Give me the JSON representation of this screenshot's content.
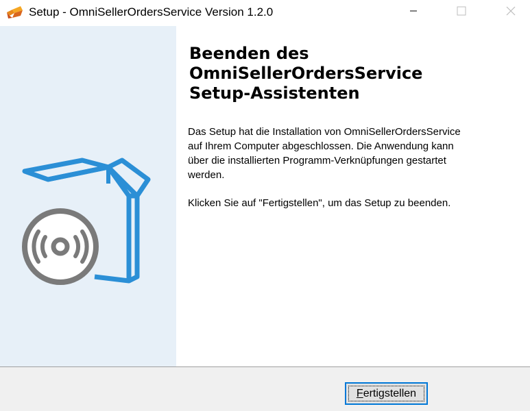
{
  "window": {
    "title": "Setup - OmniSellerOrdersService Version 1.2.0",
    "icon": "setup-wizard-icon"
  },
  "controls": {
    "minimize_icon": "minimize-icon",
    "maximize_icon": "maximize-icon",
    "close_icon": "close-icon"
  },
  "side_panel": {
    "illustration": "software-box-with-disc",
    "colors": {
      "background": "#e7f0f8",
      "box": "#2b8fd6",
      "disc": "#7a7a7a"
    }
  },
  "content": {
    "heading_lines": [
      "Beenden des",
      "OmniSellerOrdersService",
      "Setup-Assistenten"
    ],
    "paragraph1_lines": [
      "Das Setup hat die Installation von OmniSellerOrdersService",
      "auf Ihrem Computer abgeschlossen. Die Anwendung kann",
      "über die installierten Programm-Verknüpfungen gestartet",
      "werden."
    ],
    "paragraph2": "Klicken Sie auf \"Fertigstellen\", um das Setup zu beenden."
  },
  "footer": {
    "finish_button": {
      "accel": "F",
      "rest": "ertigstellen",
      "accent": "#0078d7"
    }
  }
}
